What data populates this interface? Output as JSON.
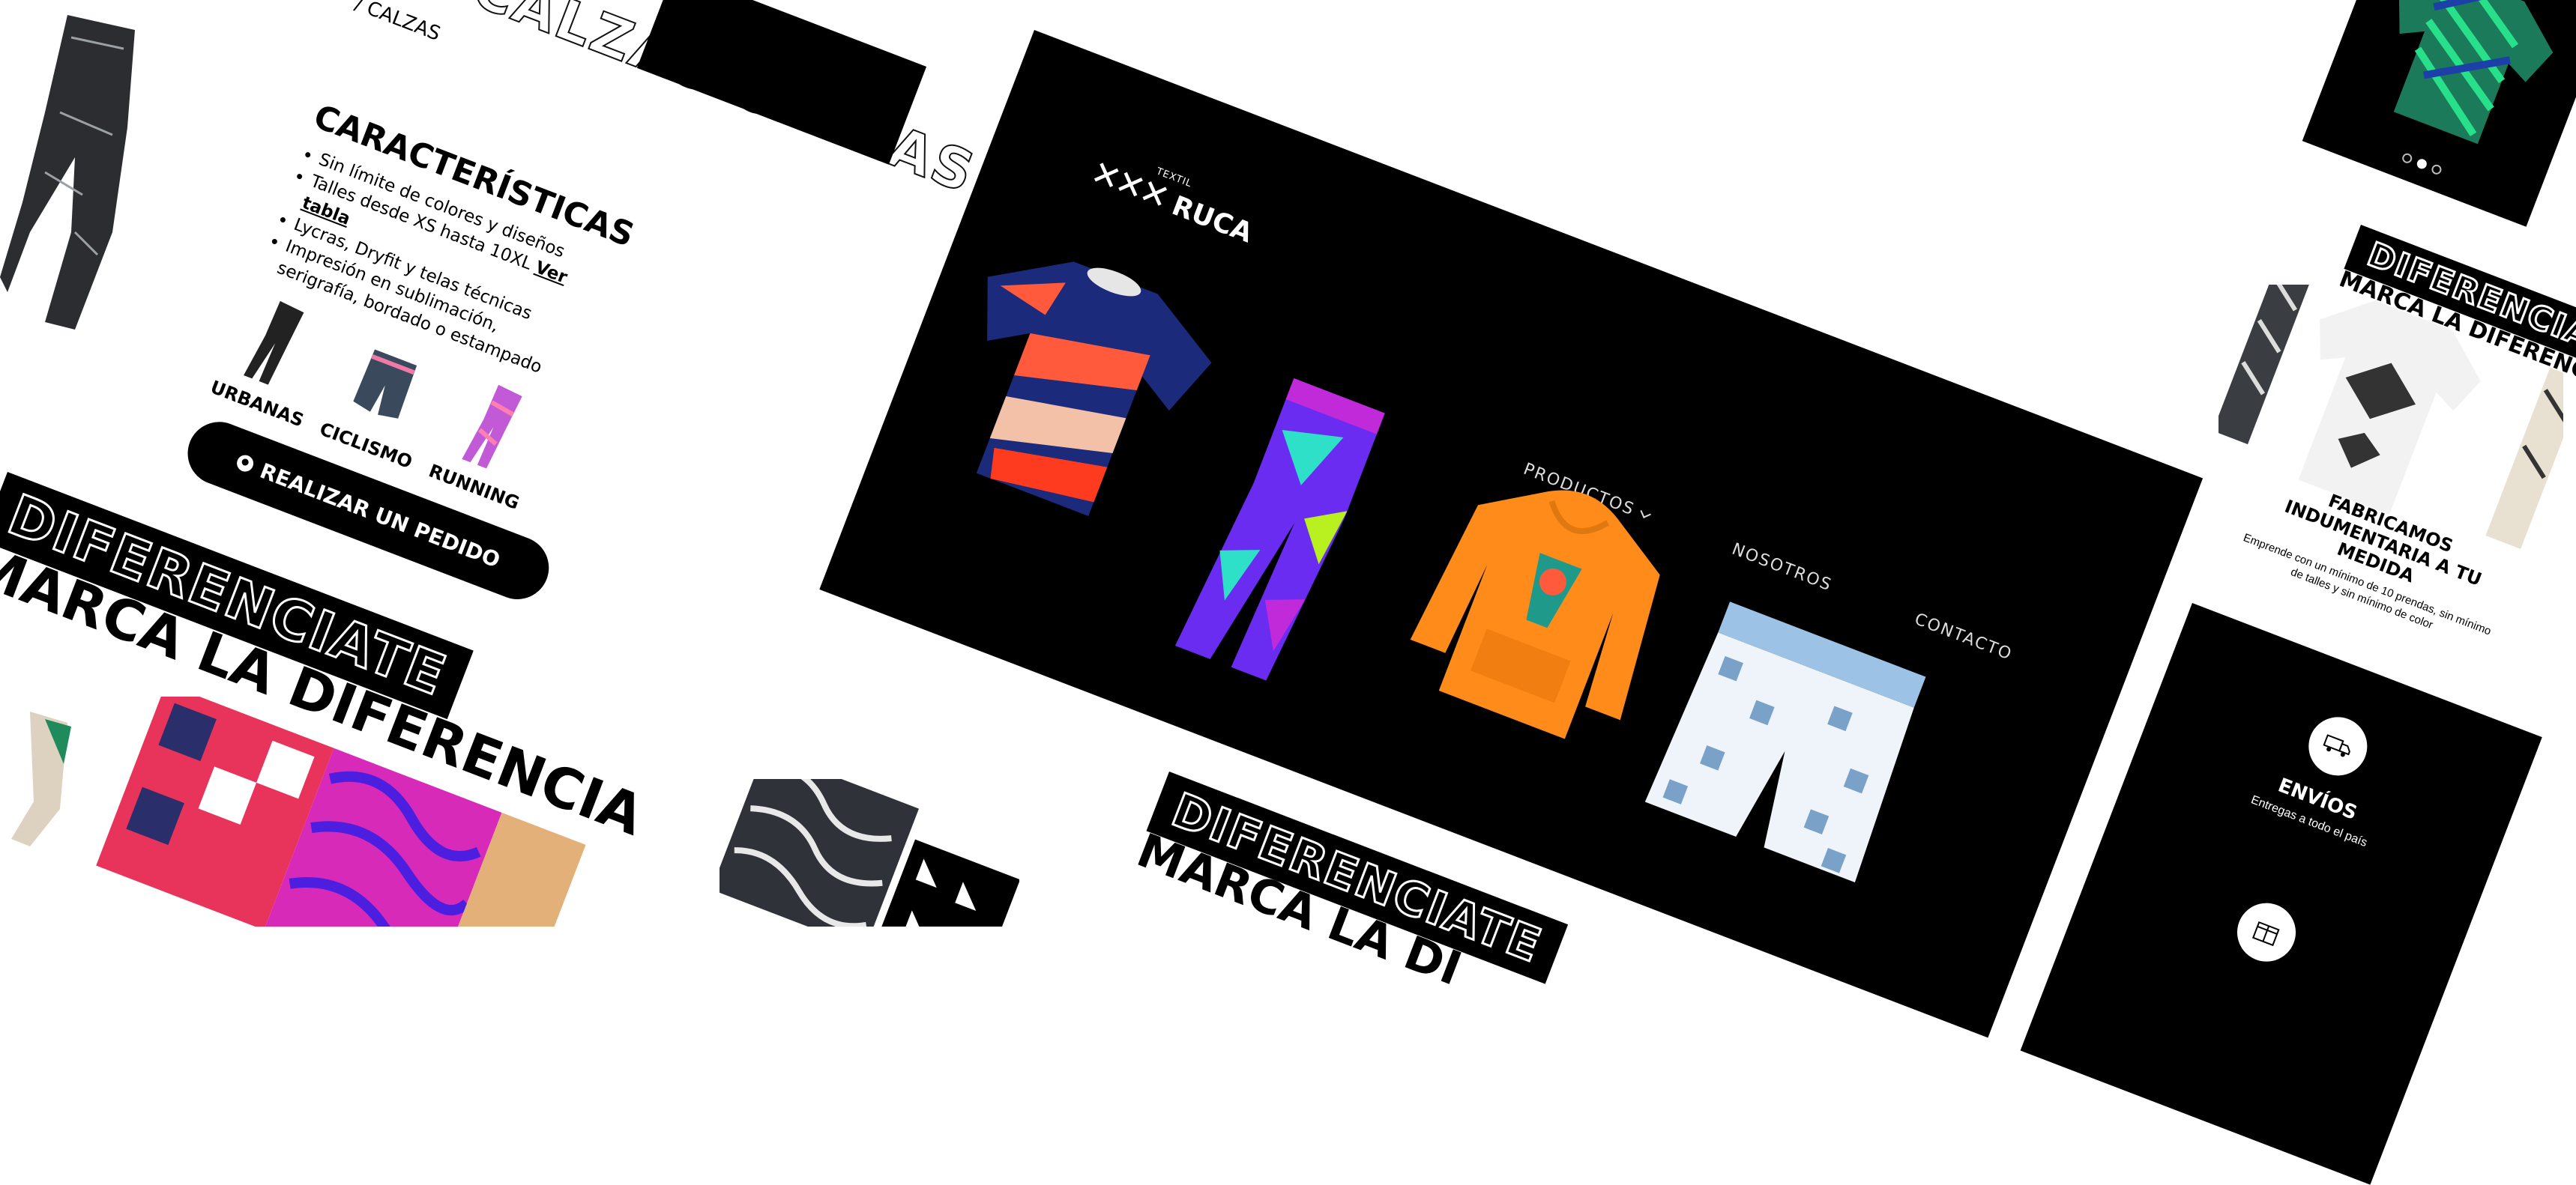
{
  "hero": {
    "logo_mark": "✕✕✕",
    "logo_name": "RUCA",
    "logo_sub": "TEXTIL",
    "nav": [
      {
        "label": "PRODUCTOS",
        "has_dropdown": true
      },
      {
        "label": "NOSOTROS",
        "has_dropdown": false
      },
      {
        "label": "CONTACTO",
        "has_dropdown": false
      }
    ],
    "garments": [
      "t-shirt",
      "leggings",
      "hoodie",
      "shorts"
    ]
  },
  "left": {
    "calzas_label": "/ CALZAS",
    "calzas_strip": "CALZAS CALZAS C",
    "caracteristicas": {
      "title": "CARACTERÍSTICAS",
      "items": [
        "Sin límite de colores y diseños",
        "Talles desde XS hasta 10XL",
        "Lycras, Dryfit y telas técnicas",
        "Impresión en sublimación, serigrafía, bordado o estampado"
      ],
      "link": "Ver tabla"
    },
    "categories": [
      "URBANAS",
      "CICLISMO",
      "RUNNING"
    ],
    "order_button": "REALIZAR UN PEDIDO",
    "dif": "DIFERENCIATE",
    "marca": "MARCÁ LA DIFERENCIA"
  },
  "center": {
    "dif": "DIFERENCIATE",
    "marca": "MARCÁ LA DI"
  },
  "right": {
    "dif": "DIFERENCIATE",
    "marca": "MARCÁ LA DIFERENCIA",
    "fab_title": "FABRICAMOS INDUMENTARIA A TU MEDIDA",
    "fab_sub": "Emprende con un mínimo de 10 prendas, sin mínimo de talles y sin mínimo de color",
    "envios_title": "ENVÍOS",
    "envios_sub": "Entregas a todo el país"
  },
  "colors": {
    "black": "#000000",
    "white": "#ffffff",
    "orange": "#ff8c1a",
    "navy": "#1b2a7a",
    "coral": "#ff5a3c",
    "purple": "#7b2cf0",
    "light_blue": "#9cc3e6"
  }
}
